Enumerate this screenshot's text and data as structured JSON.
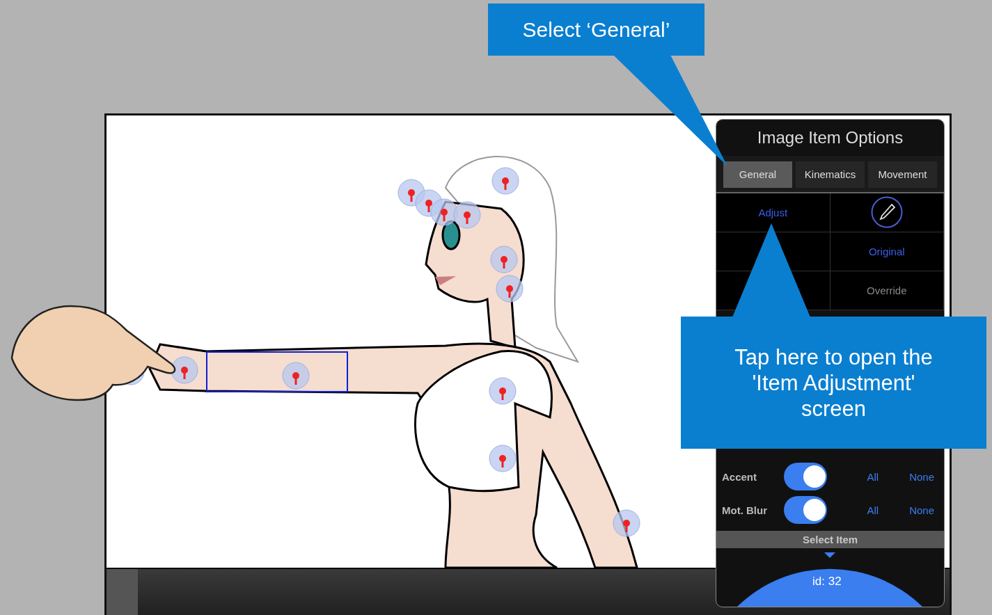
{
  "callouts": [
    {
      "text": "Select ‘General’"
    },
    {
      "text": "Tap here to open the 'Item Adjustment' screen"
    }
  ],
  "panel": {
    "title": "Image Item Options",
    "tabs": [
      {
        "label": "General",
        "selected": true
      },
      {
        "label": "Kinematics",
        "selected": false
      },
      {
        "label": "Movement",
        "selected": false
      }
    ],
    "grid": [
      {
        "kind": "link",
        "label": "Adjust"
      },
      {
        "kind": "pencil"
      },
      {
        "kind": "blank"
      },
      {
        "kind": "link",
        "label": "Original"
      },
      {
        "kind": "blank"
      },
      {
        "kind": "muted",
        "label": "Override"
      }
    ],
    "toggles": [
      {
        "label": "Accent",
        "on": true,
        "all": "All",
        "none": "None"
      },
      {
        "label": "Mot. Blur",
        "on": true,
        "all": "All",
        "none": "None"
      }
    ],
    "select_item": "Select Item",
    "dial": {
      "label": "id: 32"
    }
  }
}
